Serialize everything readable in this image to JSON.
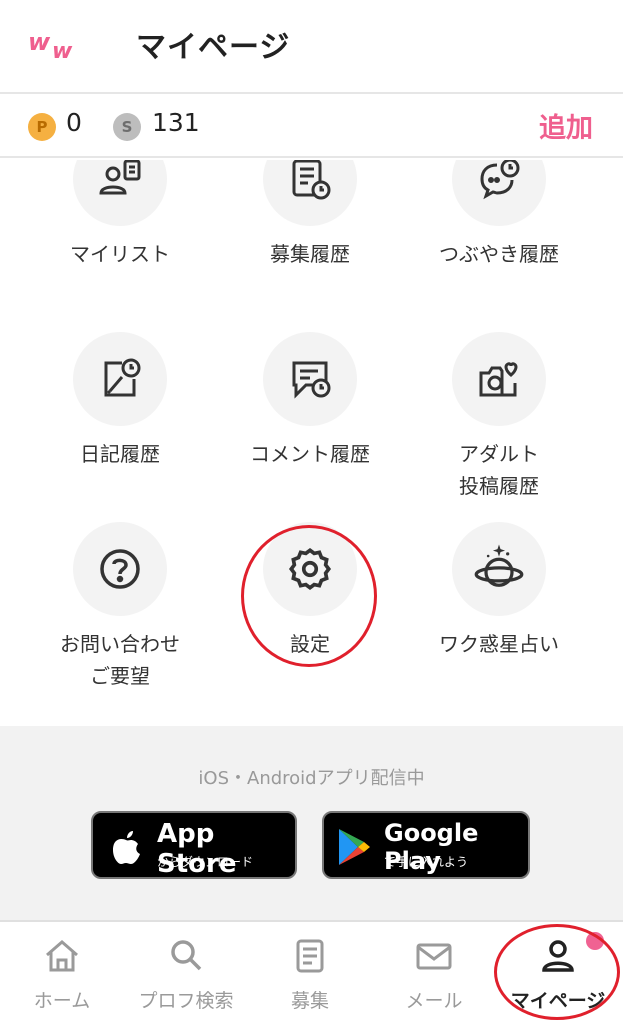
{
  "header": {
    "title": "マイページ",
    "logo_text": "ww"
  },
  "points": {
    "p_coin": "P",
    "p_value": "0",
    "s_coin": "S",
    "s_value": "131",
    "add_label": "追加"
  },
  "menu": {
    "items": [
      {
        "label": "マイリスト",
        "icon": "user-list-icon"
      },
      {
        "label": "募集履歴",
        "icon": "document-clock-icon"
      },
      {
        "label": "つぶやき履歴",
        "icon": "chat-clock-icon"
      },
      {
        "label": "日記履歴",
        "icon": "diary-clock-icon"
      },
      {
        "label": "コメント履歴",
        "icon": "comment-clock-icon"
      },
      {
        "label": "アダルト\n投稿履歴",
        "icon": "camera-heart-icon"
      },
      {
        "label": "お問い合わせ\nご要望",
        "icon": "question-circle-icon"
      },
      {
        "label": "設定",
        "icon": "gear-icon"
      },
      {
        "label": "ワク惑星占い",
        "icon": "planet-icon"
      }
    ]
  },
  "promo": {
    "text": "iOS・Androidアプリ配信中",
    "appstore_big": "App Store",
    "appstore_small": "からダウンロード",
    "googleplay_big": "Google Play",
    "googleplay_small": "で手に入れよう"
  },
  "bottom_nav": {
    "items": [
      {
        "label": "ホーム",
        "icon": "home-icon"
      },
      {
        "label": "プロフ検索",
        "icon": "search-icon"
      },
      {
        "label": "募集",
        "icon": "list-document-icon"
      },
      {
        "label": "メール",
        "icon": "mail-icon"
      },
      {
        "label": "マイページ",
        "icon": "user-icon",
        "active": true
      }
    ]
  },
  "colors": {
    "accent": "#ef5f8e",
    "annotation": "#e0202c",
    "badge": "#f06292"
  }
}
